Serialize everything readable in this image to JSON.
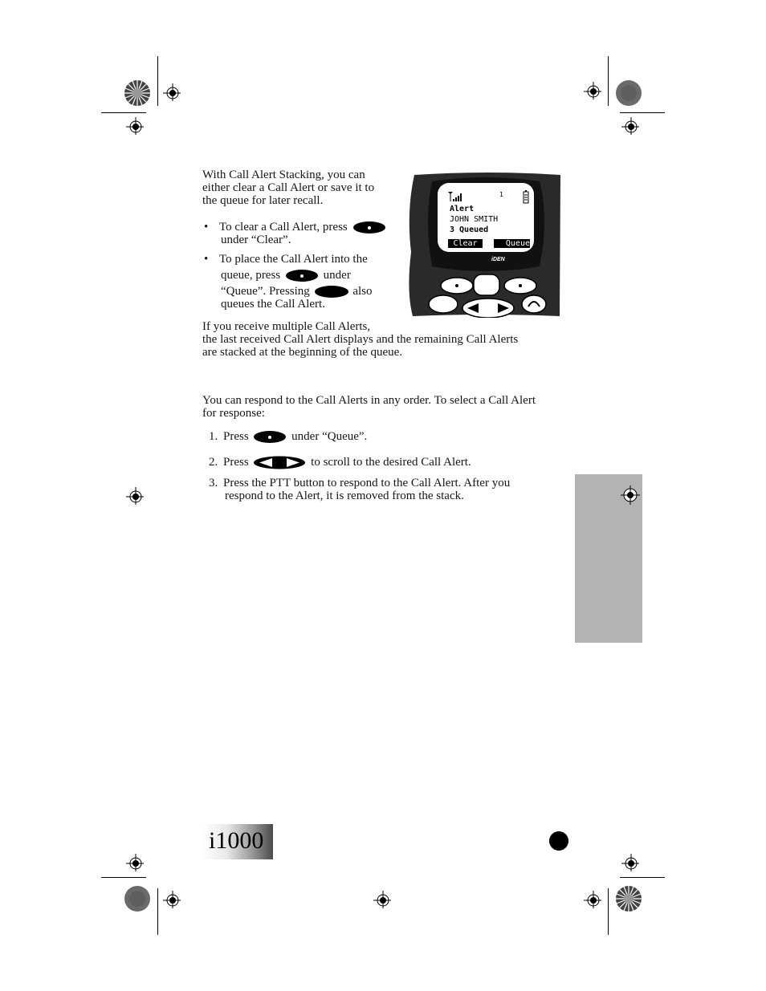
{
  "intro": {
    "lines": [
      "With Call Alert Stacking, you can",
      "either clear a Call Alert or save it to",
      "the queue for later recall."
    ]
  },
  "bullets": [
    {
      "symbol": "•",
      "line1": "To clear a Call Alert, press",
      "line2": "under “Clear”.",
      "icon": "soft-key-left-icon"
    },
    {
      "symbol": "•",
      "line1": "To place the Call Alert into the",
      "line2a": "queue, press",
      "line2b": "under",
      "line3a": "“Queue”. Pressing",
      "line3b": "also",
      "line4": "queues the Call Alert."
    }
  ],
  "multiple": {
    "lines": [
      "If you receive multiple Call Alerts,",
      "the last received Call Alert displays and the remaining Call Alerts",
      "are stacked at the beginning of the queue."
    ]
  },
  "respond": {
    "lines": [
      "You can respond to the Call Alerts in any order. To select a Call Alert",
      "for response:"
    ]
  },
  "steps": [
    {
      "num": "1.",
      "pre": "Press",
      "post": "under “Queue”."
    },
    {
      "num": "2.",
      "pre": "Press",
      "post": "to scroll to the desired Call Alert."
    },
    {
      "num": "3.",
      "line1": "Press the PTT button to respond to the Call Alert. After you",
      "line2": "respond to the Alert, it is removed from the stack."
    }
  ],
  "phone": {
    "line_indicator": "1",
    "screen_lines": [
      "Alert",
      "JOHN SMITH",
      "3 Queued"
    ],
    "softkey_left": "Clear",
    "softkey_right": "Queue",
    "brand": "iDEN"
  },
  "footer": {
    "model": "i1000"
  },
  "colors": {
    "side_tab": "#b3b3b3",
    "ink": "#000000"
  }
}
